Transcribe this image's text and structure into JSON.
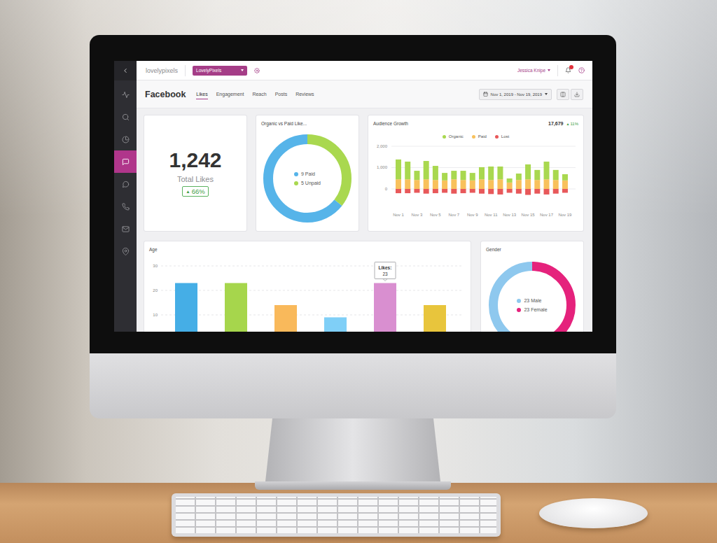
{
  "sidebar": {
    "items": [
      {
        "selected": false
      },
      {
        "selected": false
      },
      {
        "selected": false
      },
      {
        "selected": true
      },
      {
        "selected": false
      },
      {
        "selected": false
      },
      {
        "selected": false
      },
      {
        "selected": false
      }
    ]
  },
  "topbar": {
    "logo": "lovelypixels",
    "account": "LovelyPixels",
    "user": "Jessica Knipe",
    "has_notifications": true
  },
  "page": {
    "title": "Facebook",
    "tabs": [
      {
        "label": "Likes",
        "selected": true
      },
      {
        "label": "Engagement",
        "selected": false
      },
      {
        "label": "Reach",
        "selected": false
      },
      {
        "label": "Posts",
        "selected": false
      },
      {
        "label": "Reviews",
        "selected": false
      }
    ],
    "date_range": "Nov 1, 2019 - Nov 19, 2019"
  },
  "total_likes": {
    "value": "1,242",
    "label": "Total Likes",
    "arrow": "▲",
    "change": "66%"
  },
  "organic_vs_paid": {
    "title": "Organic vs Paid Like...",
    "segments": [
      {
        "label": "9 Paid",
        "value": 9,
        "color": "#56b4e9"
      },
      {
        "label": "5 Unpaid",
        "value": 5,
        "color": "#a9d84f"
      }
    ]
  },
  "audience_growth": {
    "title": "Audience Growth",
    "total": "17,679",
    "arrow": "▲",
    "change": "11%",
    "y_ticks": [
      "2,000",
      "1,000",
      "0"
    ],
    "x_labels": [
      "Nov 1",
      "Nov 3",
      "Nov 5",
      "Nov 7",
      "Nov 9",
      "Nov 11",
      "Nov 13",
      "Nov 15",
      "Nov 17",
      "Nov 19"
    ],
    "series": [
      {
        "label": "Organic",
        "color": "#a9d84f",
        "values": [
          930,
          830,
          430,
          860,
          660,
          350,
          400,
          430,
          350,
          570,
          630,
          600,
          190,
          300,
          700,
          470,
          830,
          470,
          290
        ]
      },
      {
        "label": "Paid",
        "color": "#f8c15c",
        "values": [
          450,
          450,
          420,
          450,
          420,
          400,
          450,
          420,
          400,
          450,
          420,
          450,
          300,
          420,
          450,
          420,
          450,
          420,
          400
        ]
      },
      {
        "label": "Lost",
        "color": "#e8585a",
        "values": [
          -200,
          -200,
          -180,
          -220,
          -200,
          -180,
          -220,
          -200,
          -180,
          -220,
          -240,
          -260,
          -180,
          -220,
          -280,
          -220,
          -260,
          -220,
          -180
        ]
      }
    ]
  },
  "age": {
    "title": "Age",
    "y_ticks": [
      "30",
      "20",
      "10"
    ],
    "bars": [
      {
        "value": 23,
        "color": "#45aee6",
        "hovered": false
      },
      {
        "value": 23,
        "color": "#a6d64c",
        "hovered": false
      },
      {
        "value": 14,
        "color": "#f9b95b",
        "hovered": false
      },
      {
        "value": 9,
        "color": "#7fcff7",
        "hovered": false
      },
      {
        "value": 23,
        "color": "#d98fd0",
        "hovered": true
      },
      {
        "value": 14,
        "color": "#e8c53c",
        "hovered": false
      }
    ],
    "tooltip": {
      "label": "Likes:",
      "value": "23"
    }
  },
  "gender": {
    "title": "Gender",
    "segments": [
      {
        "label": "23 Male",
        "value": 23,
        "color": "#8ec8ee"
      },
      {
        "label": "23 Female",
        "value": 23,
        "color": "#e5227c"
      }
    ]
  }
}
